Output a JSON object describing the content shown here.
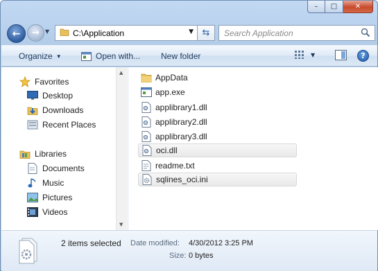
{
  "window": {
    "caption_buttons": {
      "minimize": "–",
      "maximize": "□",
      "close": "✕"
    }
  },
  "navigation": {
    "address": "C:\\Application",
    "search_placeholder": "Search Application"
  },
  "toolbar": {
    "organize_label": "Organize",
    "open_with_label": "Open with...",
    "new_folder_label": "New folder",
    "help_label": "?"
  },
  "nav_pane": {
    "favorites": {
      "label": "Favorites",
      "icon": "star-icon",
      "items": [
        {
          "label": "Desktop",
          "icon": "desktop-icon"
        },
        {
          "label": "Downloads",
          "icon": "downloads-icon"
        },
        {
          "label": "Recent Places",
          "icon": "recent-places-icon"
        }
      ]
    },
    "libraries": {
      "label": "Libraries",
      "icon": "libraries-icon",
      "items": [
        {
          "label": "Documents",
          "icon": "documents-icon"
        },
        {
          "label": "Music",
          "icon": "music-icon"
        },
        {
          "label": "Pictures",
          "icon": "pictures-icon"
        },
        {
          "label": "Videos",
          "icon": "videos-icon"
        }
      ]
    }
  },
  "files": [
    {
      "name": "AppData",
      "icon": "folder-icon",
      "selected": false
    },
    {
      "name": "app.exe",
      "icon": "exe-icon",
      "selected": false
    },
    {
      "name": "applibrary1.dll",
      "icon": "dll-icon",
      "selected": false
    },
    {
      "name": "applibrary2.dll",
      "icon": "dll-icon",
      "selected": false
    },
    {
      "name": "applibrary3.dll",
      "icon": "dll-icon",
      "selected": false
    },
    {
      "name": "oci.dll",
      "icon": "dll-icon",
      "selected": true
    },
    {
      "name": "readme.txt",
      "icon": "text-file-icon",
      "selected": false
    },
    {
      "name": "sqlines_oci.ini",
      "icon": "ini-icon",
      "selected": true
    }
  ],
  "details": {
    "selection_count": "2 items selected",
    "date_modified_label": "Date modified:",
    "date_modified_value": "4/30/2012 3:25 PM",
    "size_label": "Size:",
    "size_value": "0 bytes"
  },
  "colors": {
    "frame": "#b9d1ea",
    "command_bar": "#dce8f5",
    "details_pane": "#e6eef8",
    "selection": "#ececec"
  }
}
